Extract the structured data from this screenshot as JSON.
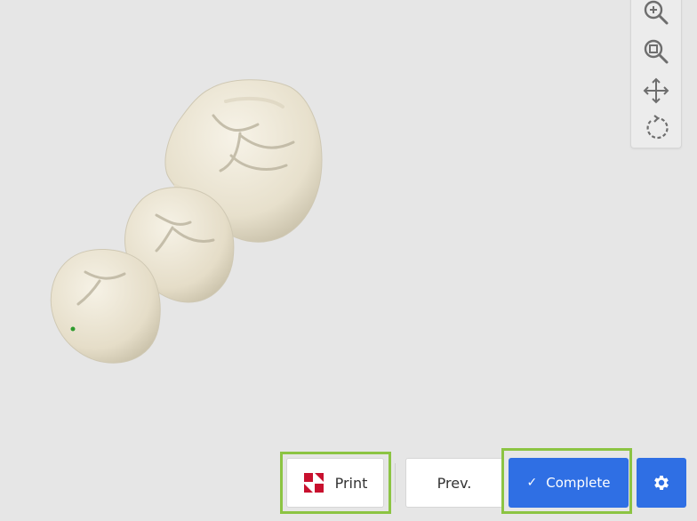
{
  "toolbar": {
    "tools": [
      {
        "name": "zoom-in",
        "icon": "zoom-in-icon"
      },
      {
        "name": "zoom-fit",
        "icon": "zoom-fit-icon"
      },
      {
        "name": "pan",
        "icon": "move-icon"
      },
      {
        "name": "rotate",
        "icon": "rotate-icon"
      }
    ]
  },
  "actions": {
    "print_label": "Print",
    "prev_label": "Prev.",
    "complete_label": "Complete",
    "complete_icon": "✓"
  },
  "colors": {
    "primary": "#2f6fe4",
    "highlight": "#8cc443",
    "background": "#e6e6e6",
    "tooth": "#ece6d6",
    "print_logo": "#c8102e"
  }
}
